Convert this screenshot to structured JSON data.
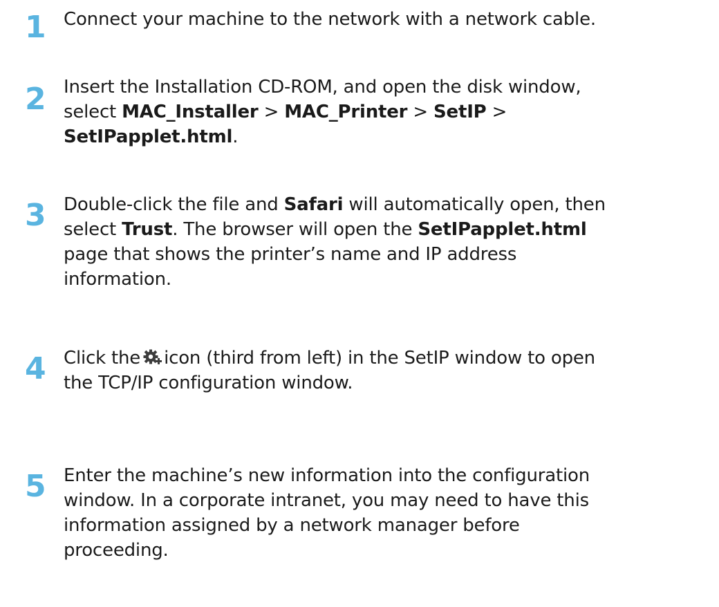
{
  "steps": [
    {
      "number": "1",
      "lines": [
        [
          "Connect your machine to the network with a network cable."
        ]
      ]
    },
    {
      "number": "2",
      "text": {
        "l1": "Insert the Installation CD-ROM, and open the disk window,",
        "l2_pre": "select ",
        "b1": "MAC_Installer",
        "sep1": " > ",
        "b2": "MAC_Printer",
        "sep2": " > ",
        "b3": "SetIP",
        "sep3": " >",
        "b4": "SetIPapplet.html",
        "end": "."
      }
    },
    {
      "number": "3",
      "text": {
        "l1_pre": "Double-click the file and ",
        "b1": "Safari",
        "l1_post": " will automatically open, then",
        "l2_pre": "select ",
        "b2": "Trust",
        "l2_mid": ". The browser will open the ",
        "b3": "SetIPapplet.html",
        "l3": "page that shows the printer’s name and IP address",
        "l4": "information."
      }
    },
    {
      "number": "4",
      "text": {
        "l1_pre": "Click the",
        "l1_post": "icon (third from left) in the SetIP window to open",
        "l2": "the TCP/IP configuration window."
      },
      "icon": "settings-gear-add-icon"
    },
    {
      "number": "5",
      "text": {
        "l1": "Enter the machine’s new information into the configuration",
        "l2": "window. In a corporate intranet, you may need to have this",
        "l3": "information assigned by a network manager before",
        "l4": "proceeding."
      }
    }
  ],
  "colors": {
    "step_number": "#5ab4e0",
    "text": "#1a1a1a"
  }
}
